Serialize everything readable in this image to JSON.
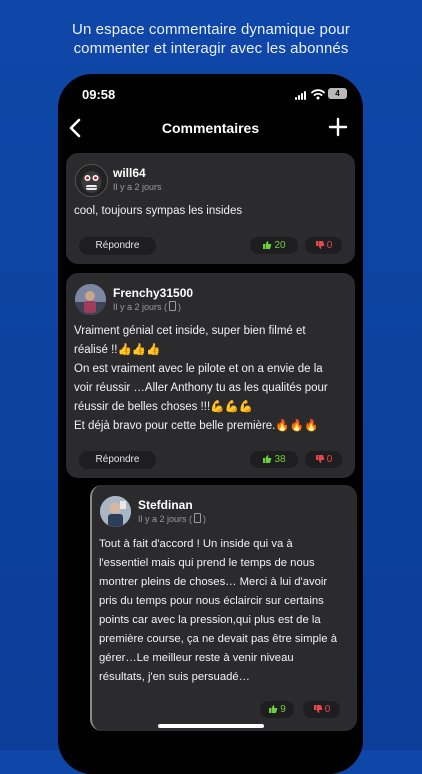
{
  "promo": {
    "line1": "Un espace commentaire dynamique pour",
    "line2": "commenter et interagir avec les abonnés"
  },
  "status_bar": {
    "time": "09:58",
    "battery": "4"
  },
  "nav": {
    "title": "Commentaires",
    "back_icon": "chevron-left-icon",
    "add_icon": "plus-icon"
  },
  "comments": [
    {
      "author": "will64",
      "time": "Il y a 2 jours",
      "device": "",
      "lines": [
        "cool, toujours sympas les insides"
      ],
      "reply_label": "Répondre",
      "likes": "20",
      "dislikes": "0"
    },
    {
      "author": "Frenchy31500",
      "time": "Il y a 2 jours (",
      "device_close": ")",
      "lines": [
        "Vraiment génial cet inside, super bien filmé et",
        "réalisé !!👍👍👍",
        "On est vraiment avec le pilote et on a envie de la",
        "voir réussir …Aller Anthony tu as les qualités pour",
        "réussir de belles choses !!!💪💪💪",
        "Et déjà bravo pour cette belle première.🔥🔥🔥"
      ],
      "reply_label": "Répondre",
      "likes": "38",
      "dislikes": "0"
    },
    {
      "author": "Stefdinan",
      "time": "Il y a 2 jours (",
      "device_close": ")",
      "lines": [
        "Tout à fait d'accord ! Un inside qui va à",
        "l'essentiel mais qui prend le temps de nous",
        "montrer pleins de choses… Merci à lui d'avoir",
        "pris du temps pour nous éclaircir sur certains",
        "points car avec la pression,qui plus est de la",
        "première course, ça ne devait pas être simple à",
        "gérer…Le meilleur reste à venir niveau",
        "résultats, j'en suis persuadé…"
      ],
      "likes": "9",
      "dislikes": "0"
    }
  ],
  "colors": {
    "background": "#0f47a8",
    "card": "#2b2b2d",
    "like": "#6fcf3a",
    "dislike": "#e54848"
  }
}
